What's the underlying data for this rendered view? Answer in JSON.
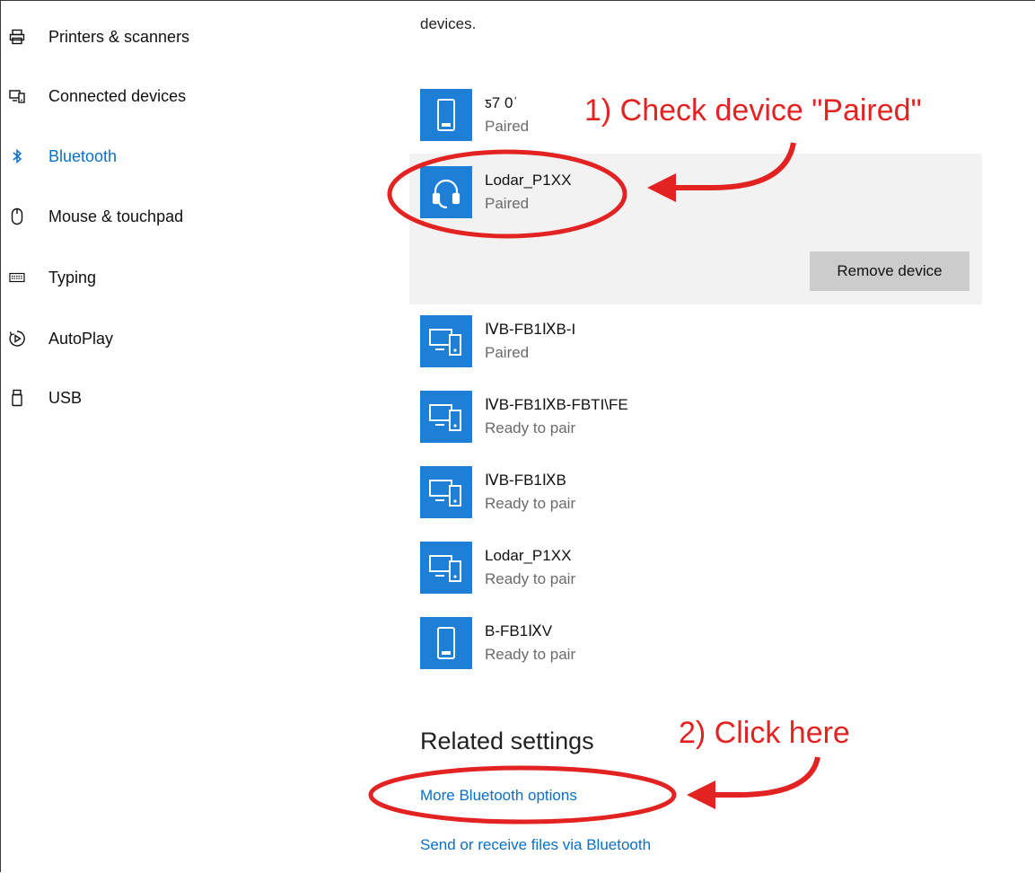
{
  "intro_text": "devices.",
  "sidebar": {
    "items": [
      {
        "label": "Printers & scanners",
        "icon": "printer-icon",
        "active": false
      },
      {
        "label": "Connected devices",
        "icon": "connected-devices-icon",
        "active": false
      },
      {
        "label": "Bluetooth",
        "icon": "bluetooth-icon",
        "active": true
      },
      {
        "label": "Mouse & touchpad",
        "icon": "mouse-icon",
        "active": false
      },
      {
        "label": "Typing",
        "icon": "keyboard-icon",
        "active": false
      },
      {
        "label": "AutoPlay",
        "icon": "autoplay-icon",
        "active": false
      },
      {
        "label": "USB",
        "icon": "usb-icon",
        "active": false
      }
    ]
  },
  "devices": [
    {
      "name": "ƽ7 0ˈ",
      "status": "Paired",
      "icon": "phone-icon"
    },
    {
      "name": "Lodar_P1XX",
      "status": "Paired",
      "icon": "headset-icon",
      "selected": true,
      "action_label": "Remove device"
    },
    {
      "name": "ⅣB-FB1ⅨB-I",
      "status": "Paired",
      "icon": "computer-phone-icon"
    },
    {
      "name": "ⅣB-FB1ⅨB-FBTI\\FE",
      "status": "Ready to pair",
      "icon": "computer-phone-icon"
    },
    {
      "name": "ⅣB-FB1ⅨB",
      "status": "Ready to pair",
      "icon": "computer-phone-icon"
    },
    {
      "name": "Lodar_P1XX",
      "status": "Ready to pair",
      "icon": "computer-phone-icon"
    },
    {
      "name": "B-FB1ⅨV",
      "status": "Ready to pair",
      "icon": "phone-icon"
    }
  ],
  "related": {
    "heading": "Related settings",
    "links": [
      "More Bluetooth options",
      "Send or receive files via Bluetooth"
    ]
  },
  "annotations": {
    "step1": "1) Check device \"Paired\"",
    "step2": "2) Click here",
    "color": "#e32222"
  },
  "colors": {
    "accent": "#0a6fc8",
    "icon_tile": "#1e7fd6",
    "selected_bg": "#f2f2f2",
    "button_bg": "#cccccc"
  }
}
